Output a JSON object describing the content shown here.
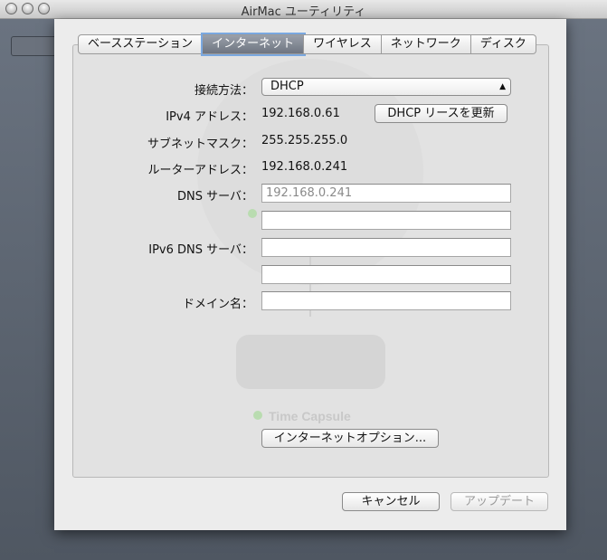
{
  "window": {
    "title": "AirMac ユーティリティ"
  },
  "tabs": [
    {
      "label": "ベースステーション"
    },
    {
      "label": "インターネット",
      "active": true
    },
    {
      "label": "ワイヤレス"
    },
    {
      "label": "ネットワーク"
    },
    {
      "label": "ディスク"
    }
  ],
  "form": {
    "connect_method": {
      "label": "接続方法：",
      "value": "DHCP"
    },
    "ipv4": {
      "label": "IPv4 アドレス：",
      "value": "192.168.0.61"
    },
    "renew_button": "DHCP リースを更新",
    "subnet": {
      "label": "サブネットマスク：",
      "value": "255.255.255.0"
    },
    "router": {
      "label": "ルーターアドレス：",
      "value": "192.168.0.241"
    },
    "dns": {
      "label": "DNS サーバ：",
      "field1_placeholder": "192.168.0.241",
      "field2_value": ""
    },
    "ipv6_dns": {
      "label": "IPv6 DNS サーバ：",
      "field1_value": "",
      "field2_value": ""
    },
    "domain": {
      "label": "ドメイン名：",
      "value": ""
    },
    "internet_options_button": "インターネットオプション..."
  },
  "background": {
    "device_label": "Time Capsule"
  },
  "footer": {
    "cancel_label": "キャンセル",
    "update_label": "アップデート"
  },
  "colors": {
    "active_tab": "#7e8590",
    "focus_ring": "#7aa8e0",
    "status_dot": "#7fcf6a"
  }
}
